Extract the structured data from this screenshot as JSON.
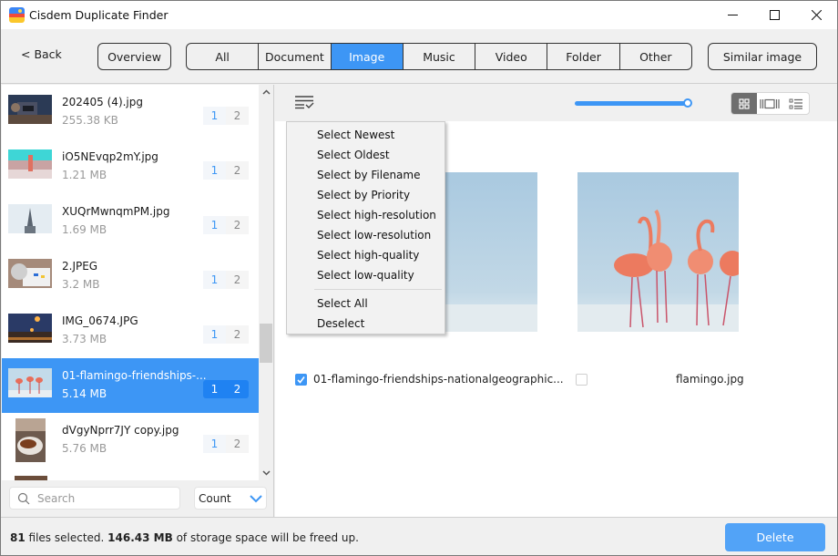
{
  "window": {
    "title": "Cisdem Duplicate Finder",
    "controls": [
      "minimize",
      "maximize",
      "close"
    ]
  },
  "nav": {
    "back_label": "< Back",
    "overview_label": "Overview",
    "tabs": [
      {
        "label": "All",
        "active": false
      },
      {
        "label": "Document",
        "active": false
      },
      {
        "label": "Image",
        "active": true
      },
      {
        "label": "Music",
        "active": false
      },
      {
        "label": "Video",
        "active": false
      },
      {
        "label": "Folder",
        "active": false
      },
      {
        "label": "Other",
        "active": false
      }
    ],
    "similar_image_label": "Similar image"
  },
  "sidebar": {
    "items": [
      {
        "name": "202405 (4).jpg",
        "size": "255.38 KB",
        "counts": [
          "1",
          "2"
        ],
        "selected": false
      },
      {
        "name": "iO5NEvqp2mY.jpg",
        "size": "1.21 MB",
        "counts": [
          "1",
          "2"
        ],
        "selected": false
      },
      {
        "name": "XUQrMwnqmPM.jpg",
        "size": "1.69 MB",
        "counts": [
          "1",
          "2"
        ],
        "selected": false
      },
      {
        "name": "2.JPEG",
        "size": "3.2 MB",
        "counts": [
          "1",
          "2"
        ],
        "selected": false
      },
      {
        "name": "IMG_0674.JPG",
        "size": "3.73 MB",
        "counts": [
          "1",
          "2"
        ],
        "selected": false
      },
      {
        "name": "01-flamingo-friendships-...",
        "size": "5.14 MB",
        "counts": [
          "1",
          "2"
        ],
        "selected": true
      },
      {
        "name": "dVgyNprr7JY copy.jpg",
        "size": "5.76 MB",
        "counts": [
          "1",
          "2"
        ],
        "selected": false
      }
    ],
    "search_placeholder": "Search",
    "sort_value": "Count"
  },
  "main": {
    "slider_value_percent": 100,
    "view_modes": [
      {
        "icon": "grid-view-icon",
        "active": true
      },
      {
        "icon": "carousel-view-icon",
        "active": false
      },
      {
        "icon": "list-view-icon",
        "active": false
      }
    ],
    "cards": [
      {
        "filename": "01-flamingo-friendships-nationalgeographic...",
        "checked": true
      },
      {
        "filename": "flamingo.jpg",
        "checked": false
      }
    ]
  },
  "select_menu": {
    "group1": [
      "Select Newest",
      "Select Oldest",
      "Select by Filename",
      "Select by Priority",
      "Select high-resolution",
      "Select low-resolution",
      "Select high-quality",
      "Select low-quality"
    ],
    "group2": [
      "Select All",
      "Deselect"
    ]
  },
  "footer": {
    "files_count": "81",
    "files_text": "files selected.",
    "size": "146.43 MB",
    "size_text": "of storage space will be freed up.",
    "delete_label": "Delete"
  },
  "colors": {
    "accent": "#3d96f5",
    "delete_button": "#52a3f7",
    "badge_selected": "#1f82f2"
  }
}
